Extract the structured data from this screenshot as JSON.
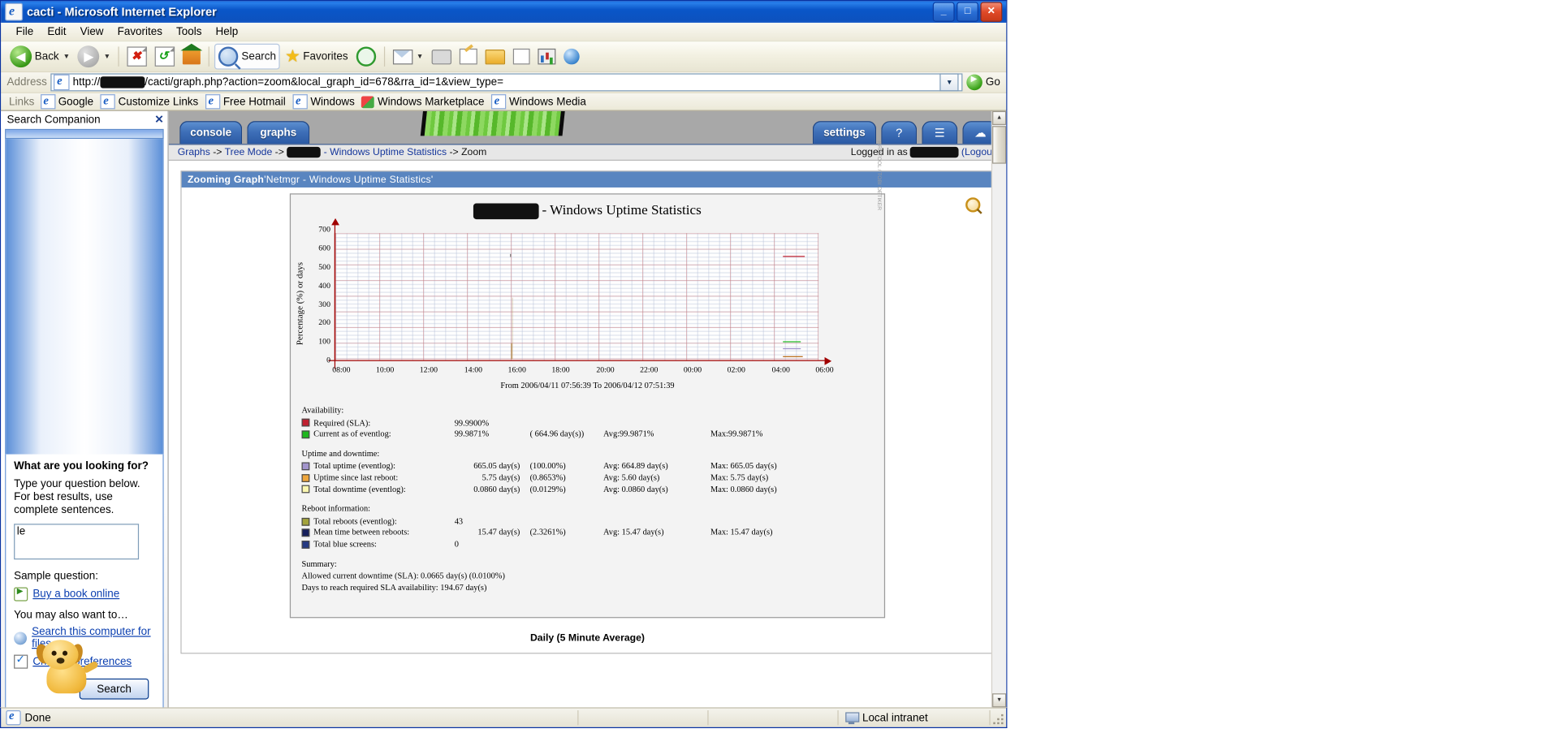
{
  "window": {
    "title": "cacti - Microsoft Internet Explorer",
    "icon": "ie-document-icon",
    "minimize": "_",
    "maximize": "□",
    "close": "✕"
  },
  "menubar": [
    {
      "label": "File"
    },
    {
      "label": "Edit"
    },
    {
      "label": "View"
    },
    {
      "label": "Favorites"
    },
    {
      "label": "Tools"
    },
    {
      "label": "Help"
    }
  ],
  "toolbar": {
    "back_label": "Back",
    "forward_label": "",
    "stop_label": "",
    "refresh_label": "",
    "home_label": "",
    "search_label": "Search",
    "favorites_label": "Favorites",
    "history_label": "",
    "mail_label": "",
    "print_label": "",
    "edit_label": "",
    "discuss_label": "",
    "messenger_label": "",
    "research_label": "",
    "media_label": ""
  },
  "address": {
    "label": "Address",
    "url_prefix": "http://",
    "url_redacted": "█████",
    "url_suffix": "/cacti/graph.php?action=zoom&local_graph_id=678&rra_id=1&view_type=",
    "go_label": "Go",
    "dropdown_icon": "chevron-down-icon"
  },
  "links": {
    "label": "Links",
    "items": [
      {
        "label": "Google",
        "icon": "ie-icon"
      },
      {
        "label": "Customize Links",
        "icon": "ie-icon"
      },
      {
        "label": "Free Hotmail",
        "icon": "ie-icon"
      },
      {
        "label": "Windows",
        "icon": "ie-icon"
      },
      {
        "label": "Windows Marketplace",
        "icon": "marketplace-icon"
      },
      {
        "label": "Windows Media",
        "icon": "ie-icon"
      }
    ]
  },
  "sidebar": {
    "title": "Search Companion",
    "close_icon": "close-icon",
    "heading": "What are you looking for?",
    "hint": "Type your question below. For best results, use complete sentences.",
    "input_value": "le",
    "sample_label": "Sample question:",
    "sample_link": "Buy a book online",
    "also_label": "You may also want to…",
    "option_files": "Search this computer for files",
    "option_prefs": "Change preferences",
    "search_button": "Search",
    "assistant": "dog-assistant"
  },
  "cacti": {
    "tabs": [
      {
        "label": "console",
        "active": false
      },
      {
        "label": "graphs",
        "active": true
      }
    ],
    "right_tabs": [
      {
        "label": "settings",
        "icon": ""
      },
      {
        "label": "",
        "icon": "help-icon"
      },
      {
        "label": "",
        "icon": "list-icon"
      },
      {
        "label": "",
        "icon": "cloud-icon"
      }
    ],
    "breadcrumb": {
      "item1": "Graphs",
      "sep1": " -> ",
      "item2": "Tree Mode",
      "sep2": " -> ",
      "redacted": "████",
      "item3": " - Windows Uptime Statistics",
      "sep3": " -> ",
      "item4": "Zoom"
    },
    "logged_in": "Logged in as ",
    "logged_user": "██████",
    "logout": "(Logout)",
    "panel_title_prefix": "Zooming Graph ",
    "panel_title_name": "'Netmgr - Windows Uptime Statistics'",
    "footer": "Daily (5 Minute Average)",
    "zoom_tool_icon": "magnifier-icon"
  },
  "chart_data": {
    "type": "line",
    "title": "█████ - Windows Uptime Statistics",
    "title_redacted": "██████",
    "title_suffix": " - Windows Uptime Statistics",
    "ylabel": "Percentage (%) or days",
    "xlabel": "From 2006/04/11 07:56:39 To 2006/04/12 07:51:39",
    "ylim": [
      0,
      760
    ],
    "yticks": [
      0,
      100,
      200,
      300,
      400,
      500,
      600,
      700
    ],
    "xticks": [
      "08:00",
      "10:00",
      "12:00",
      "14:00",
      "16:00",
      "18:00",
      "20:00",
      "22:00",
      "00:00",
      "02:00",
      "04:00",
      "06:00"
    ],
    "grid": true,
    "watermark": "RRDTOOL / TOBI OETIKER",
    "series": [
      {
        "name": "Required (SLA)",
        "color": "#b01020",
        "value": 99.99
      },
      {
        "name": "Current as of eventlog",
        "color": "#20a020",
        "value": 99.9871
      },
      {
        "name": "Total uptime (eventlog)",
        "color": "#9d8fc4",
        "value": 665.05
      },
      {
        "name": "Uptime since last reboot",
        "color": "#eaa13a",
        "value": 5.75
      },
      {
        "name": "Total downtime (eventlog)",
        "color": "#f7f2a0",
        "value": 0.086
      },
      {
        "name": "Total reboots (eventlog)",
        "color": "#9a9a3a",
        "value": 43
      },
      {
        "name": "Mean time between reboots",
        "color": "#1e2a6e",
        "value": 15.47
      },
      {
        "name": "Total blue screens",
        "color": "#2b3f8f",
        "value": 0
      }
    ]
  },
  "stats": {
    "availability": {
      "head": "Availability:",
      "rows": [
        {
          "swatch": "#c02030",
          "label": "Required (SLA):",
          "v1": "99.9900%",
          "v2": "",
          "v3": "",
          "v4": ""
        },
        {
          "swatch": "#1eb81e",
          "label": "Current as of eventlog:",
          "v1": "99.9871%",
          "v2": "(  664.96 day(s))",
          "v3": "Avg:99.9871%",
          "v4": "Max:99.9871%"
        }
      ]
    },
    "uptime": {
      "head": "Uptime and downtime:",
      "rows": [
        {
          "swatch": "#a294cc",
          "label": "Total uptime (eventlog):",
          "v1": "665.05 day(s)",
          "v2": "(100.00%)",
          "v3": "Avg:  664.89 day(s)",
          "v4": "Max:  665.05 day(s)"
        },
        {
          "swatch": "#efa63c",
          "label": "Uptime since last reboot:",
          "v1": "5.75 day(s)",
          "v2": "(0.8653%)",
          "v3": "Avg:   5.60 day(s)",
          "v4": "Max:   5.75 day(s)"
        },
        {
          "swatch": "#fbf7b0",
          "label": "Total downtime (eventlog):",
          "v1": "0.0860 day(s)",
          "v2": "(0.0129%)",
          "v3": "Avg:  0.0860 day(s)",
          "v4": "Max:  0.0860 day(s)"
        }
      ]
    },
    "reboot": {
      "head": "Reboot information:",
      "rows": [
        {
          "swatch": "#a3a33c",
          "label": "Total reboots (eventlog):",
          "v1": "43",
          "v2": "",
          "v3": "",
          "v4": ""
        },
        {
          "swatch": "#17205e",
          "label": "Mean time between reboots:",
          "v1": "15.47 day(s)",
          "v2": "(2.3261%)",
          "v3": "Avg:  15.47 day(s)",
          "v4": "Max:  15.47 day(s)"
        },
        {
          "swatch": "#253a84",
          "label": "Total blue screens:",
          "v1": "0",
          "v2": "",
          "v3": "",
          "v4": ""
        }
      ]
    },
    "summary": {
      "head": "Summary:",
      "line1": "Allowed current downtime (SLA):  0.0665 day(s)     (0.0100%)",
      "line2": "Days to reach required SLA availability:  194.67 day(s)"
    }
  },
  "statusbar": {
    "done": "Done",
    "zone": "Local intranet",
    "zone_icon": "intranet-icon"
  }
}
